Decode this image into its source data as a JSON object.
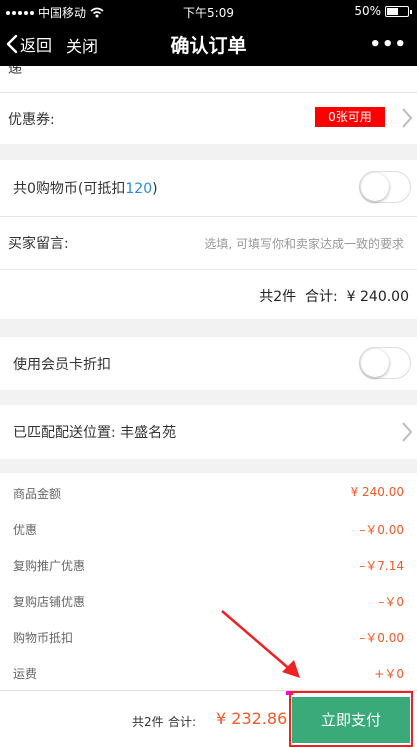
{
  "status": {
    "carrier": "中国移动",
    "time": "下午5:09",
    "battery": "50%"
  },
  "nav": {
    "back": "返回",
    "close": "关闭",
    "title": "确认订单",
    "more": "•••"
  },
  "partial_row": "递",
  "coupon": {
    "label": "优惠券:",
    "badge": "0张可用",
    "badge_color": "#ff0000"
  },
  "coins": {
    "label_prefix": "共0购物币(可抵扣",
    "amount": "120",
    "label_suffix": ")",
    "amount_color": "#2a8ae0"
  },
  "message": {
    "label": "买家留言:",
    "placeholder": "选填, 可填写你和卖家达成一致的要求"
  },
  "order_total": {
    "count": "共2件",
    "label": "合计:",
    "amount": "¥ 240.00"
  },
  "member_card": {
    "label": "使用会员卡折扣"
  },
  "delivery": {
    "label": "已匹配配送位置: 丰盛名苑"
  },
  "summary": [
    {
      "label": "商品金额",
      "value": "¥ 240.00"
    },
    {
      "label": "优惠",
      "value": "–￥0.00"
    },
    {
      "label": "复购推广优惠",
      "value": "–￥7.14"
    },
    {
      "label": "复购店铺优惠",
      "value": "–￥0"
    },
    {
      "label": "购物币抵扣",
      "value": "–￥0.00"
    },
    {
      "label": "运费",
      "value": "+￥0"
    }
  ],
  "bottom": {
    "count": "共2件",
    "total_label": "合计:",
    "total": "¥ 232.86",
    "pay_button": "立即支付",
    "accent": "#f05a28",
    "pay_color": "#3aaa7a"
  }
}
